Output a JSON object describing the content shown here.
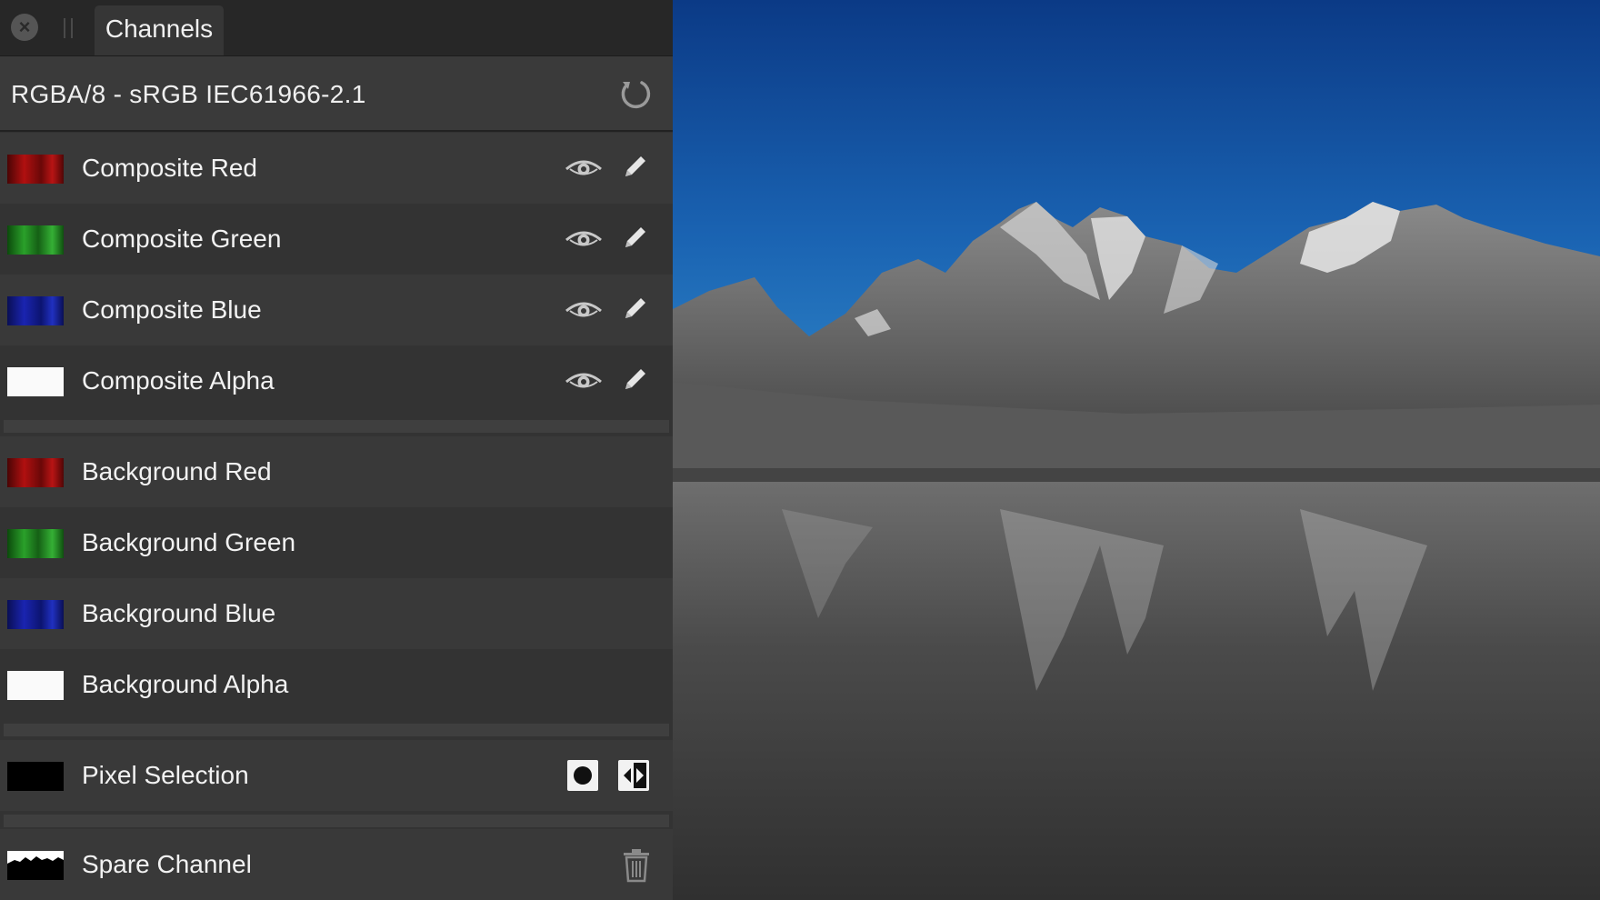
{
  "tab": {
    "title": "Channels"
  },
  "header": {
    "format": "RGBA/8 - sRGB IEC61966-2.1"
  },
  "composite": [
    {
      "label": "Composite Red",
      "swatch": "#b01010"
    },
    {
      "label": "Composite Green",
      "swatch": "#1f8f1f"
    },
    {
      "label": "Composite Blue",
      "swatch": "#1a24a8"
    },
    {
      "label": "Composite Alpha",
      "swatch": "#ffffff"
    }
  ],
  "background": [
    {
      "label": "Background Red",
      "swatch": "#b01010"
    },
    {
      "label": "Background Green",
      "swatch": "#1f8f1f"
    },
    {
      "label": "Background Blue",
      "swatch": "#1a24a8"
    },
    {
      "label": "Background Alpha",
      "swatch": "#ffffff"
    }
  ],
  "pixel_selection": {
    "label": "Pixel Selection"
  },
  "spare_channel": {
    "label": "Spare Channel"
  },
  "icons": {
    "close": "close-icon",
    "refresh": "refresh-icon",
    "visibility": "eye-icon",
    "edit": "pencil-icon",
    "fill": "circle-fill-icon",
    "invert": "invert-icon",
    "delete": "trash-icon"
  }
}
